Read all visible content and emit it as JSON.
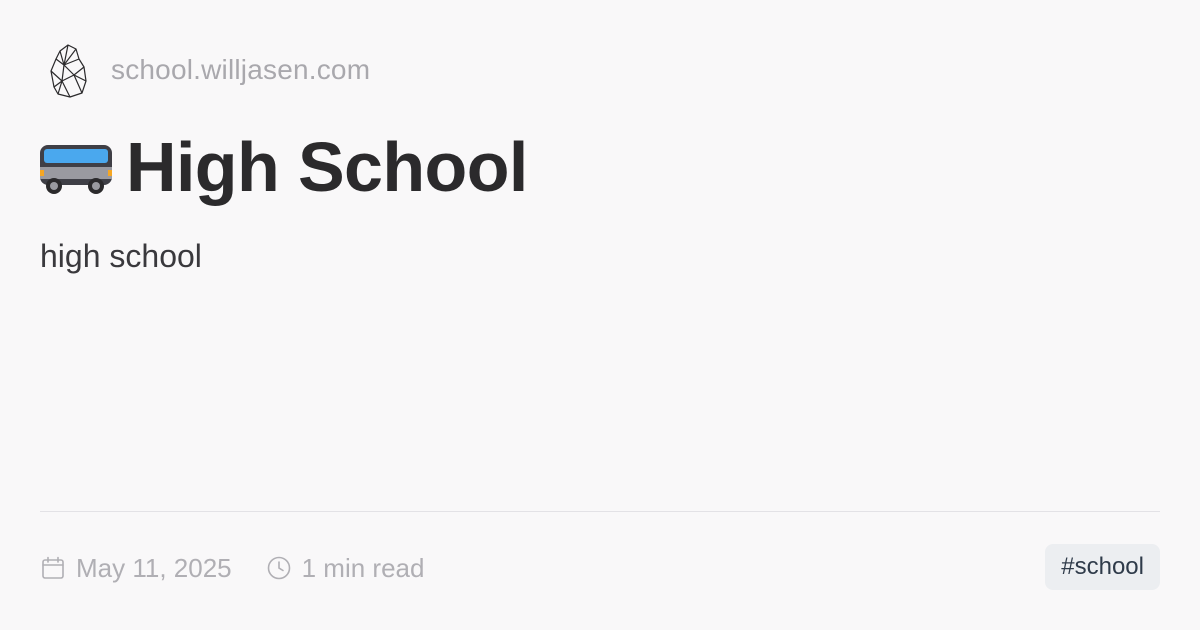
{
  "header": {
    "site_url": "school.willjasen.com",
    "logo_icon": "crystal-logo-icon"
  },
  "post": {
    "title_icon": "bus-icon",
    "title": "High School",
    "description": "high school"
  },
  "meta": {
    "date_icon": "calendar-icon",
    "date": "May 11, 2025",
    "read_time_icon": "clock-icon",
    "read_time": "1 min read"
  },
  "tags": [
    {
      "label": "#school"
    }
  ],
  "colors": {
    "background": "#f9f8f9",
    "title": "#2b2a2c",
    "muted_text": "#a9a8ad",
    "tag_background": "#eceef1",
    "tag_text": "#2f3b4a",
    "bus_body": "#3f3f46",
    "bus_window": "#4aa8ee",
    "bus_trim": "#9a9aa0"
  }
}
